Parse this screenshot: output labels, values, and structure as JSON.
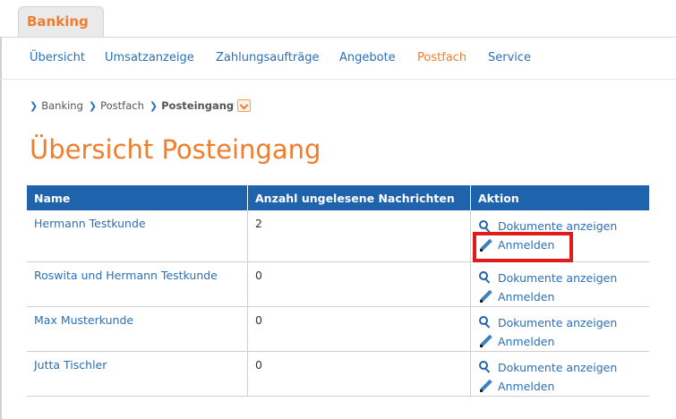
{
  "tabs": {
    "active_label": "Banking"
  },
  "nav": [
    {
      "label": "Übersicht",
      "active": false
    },
    {
      "label": "Umsatzanzeige",
      "active": false
    },
    {
      "label": "Zahlungsaufträge",
      "active": false
    },
    {
      "label": "Angebote",
      "active": false
    },
    {
      "label": "Postfach",
      "active": true
    },
    {
      "label": "Service",
      "active": false
    }
  ],
  "breadcrumb": [
    "Banking",
    "Postfach",
    "Posteingang"
  ],
  "page_title": "Übersicht Posteingang",
  "table": {
    "headers": [
      "Name",
      "Anzahl ungelesene Nachrichten",
      "Aktion"
    ],
    "rows": [
      {
        "name": "Hermann Testkunde",
        "count": "2",
        "action_docs": "Dokumente anzeigen",
        "action_login": "Anmelden"
      },
      {
        "name": "Roswita und Hermann Testkunde",
        "count": "0",
        "action_docs": "Dokumente anzeigen",
        "action_login": "Anmelden"
      },
      {
        "name": "Max Musterkunde",
        "count": "0",
        "action_docs": "Dokumente anzeigen",
        "action_login": "Anmelden"
      },
      {
        "name": "Jutta Tischler",
        "count": "0",
        "action_docs": "Dokumente anzeigen",
        "action_login": "Anmelden"
      }
    ]
  },
  "icons": {
    "docs": "search-icon",
    "login": "pencil-icon"
  },
  "colors": {
    "accent": "#f17c2b",
    "link": "#2b6fb7",
    "header": "#2063ad",
    "highlight": "#e01b1b"
  }
}
